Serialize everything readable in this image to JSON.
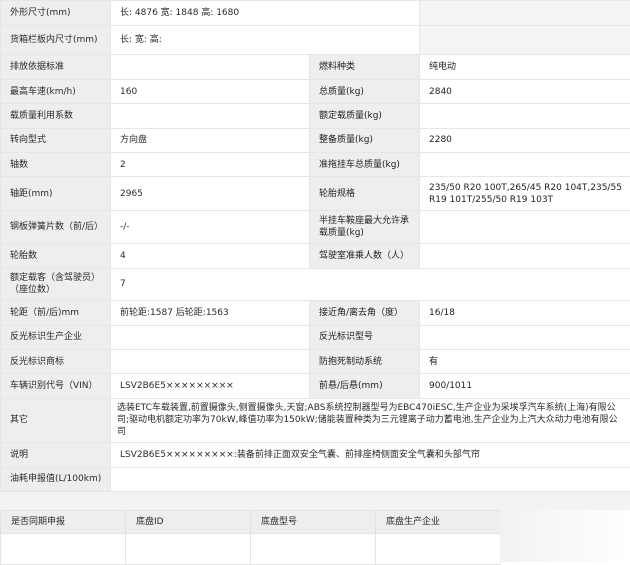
{
  "spec_rows": {
    "dimensions": {
      "label": "外形尺寸(mm)",
      "value": "长: 4876 宽: 1848 高: 1680"
    },
    "cargo_box": {
      "label": "货箱栏板内尺寸(mm)",
      "value": "长: 宽: 高:"
    },
    "emission": {
      "label": "排放依据标准",
      "value": "",
      "label2": "燃料种类",
      "value2": "纯电动"
    },
    "max_speed": {
      "label": "最高车速(km/h)",
      "value": "160",
      "label2": "总质量(kg)",
      "value2": "2840"
    },
    "load_util": {
      "label": "载质量利用系数",
      "value": "",
      "label2": "额定载质量(kg)",
      "value2": ""
    },
    "steering": {
      "label": "转向型式",
      "value": "方向盘",
      "label2": "整备质量(kg)",
      "value2": "2280"
    },
    "axles": {
      "label": "轴数",
      "value": "2",
      "label2": "准拖挂车总质量(kg)",
      "value2": ""
    },
    "wheelbase": {
      "label": "轴距(mm)",
      "value": "2965",
      "label2": "轮胎规格",
      "value2": "235/50 R20 100T,265/45 R20 104T,235/55 R19 101T/255/50 R19 103T"
    },
    "leaf_spring": {
      "label": "钢板弹簧片数（前/后）",
      "value": "-/-",
      "label2": "半挂车鞍座最大允许承载质量(kg)",
      "value2": ""
    },
    "tire_count": {
      "label": "轮胎数",
      "value": "4",
      "label2": "驾驶室准乘人数（人）",
      "value2": ""
    },
    "passengers": {
      "label": "额定载客（含驾驶员）（座位数）",
      "value": "7"
    },
    "track": {
      "label": "轮距（前/后)mm",
      "value": "前轮距:1587 后轮距:1563",
      "label2": "接近角/离去角（度）",
      "value2": "16/18"
    },
    "reflector_maker": {
      "label": "反光标识生产企业",
      "value": "",
      "label2": "反光标识型号",
      "value2": ""
    },
    "reflector_brand": {
      "label": "反光标识商标",
      "value": "",
      "label2": "防抱死制动系统",
      "value2": "有"
    },
    "vin": {
      "label": "车辆识别代号（VIN）",
      "value": "LSV2B6E5×××××××××",
      "label2": "前悬/后悬(mm)",
      "value2": "900/1011"
    },
    "other": {
      "label": "其它",
      "value": "选装ETC车载装置,前置摄像头,侧置摄像头,天窗;ABS系统控制器型号为EBC470iESC,生产企业为采埃孚汽车系统(上海)有限公司;驱动电机额定功率为70kW,峰值功率为150kW;储能装置种类为三元锂离子动力蓄电池,生产企业为上汽大众动力电池有限公司"
    },
    "notes": {
      "label": "说明",
      "value": "LSV2B6E5×××××××××:装备前排正面双安全气囊、前排座椅侧面安全气囊和头部气帘"
    },
    "fuel_consumption": {
      "label": "油耗申报值(L/100km)",
      "value": ""
    }
  },
  "chassis": {
    "headers": [
      "是否同期申报",
      "底盘ID",
      "底盘型号",
      "底盘生产企业"
    ]
  }
}
